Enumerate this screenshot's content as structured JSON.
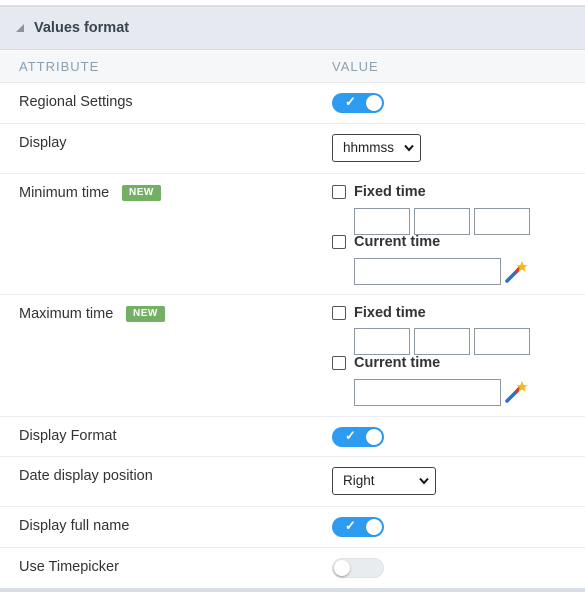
{
  "panel": {
    "title": "Values format",
    "collapse_icon": "triangle-collapse-icon"
  },
  "columns": {
    "attribute": "ATTRIBUTE",
    "value": "VALUE"
  },
  "rows": {
    "regional_settings": {
      "label": "Regional Settings",
      "toggle_on": true
    },
    "display": {
      "label": "Display",
      "selected": "hhmmss"
    },
    "minimum_time": {
      "label": "Minimum time",
      "badge": "NEW",
      "fixed_time_label": "Fixed time",
      "fixed_time_checked": false,
      "current_time_label": "Current time",
      "current_time_checked": false,
      "fixed_values": [
        "",
        "",
        ""
      ],
      "current_value": "",
      "wand_icon": "magic-wand-icon"
    },
    "maximum_time": {
      "label": "Maximum time",
      "badge": "NEW",
      "fixed_time_label": "Fixed time",
      "fixed_time_checked": false,
      "current_time_label": "Current time",
      "current_time_checked": false,
      "fixed_values": [
        "",
        "",
        ""
      ],
      "current_value": "",
      "wand_icon": "magic-wand-icon"
    },
    "display_format": {
      "label": "Display Format",
      "toggle_on": true
    },
    "date_display_position": {
      "label": "Date display position",
      "selected": "Right"
    },
    "display_full_name": {
      "label": "Display full name",
      "toggle_on": true
    },
    "use_timepicker": {
      "label": "Use Timepicker",
      "toggle_on": false
    }
  },
  "colors": {
    "accent": "#2d9cf0",
    "badge": "#74b064",
    "header_bg": "#e6eaf0",
    "column_header_text": "#8aa0b3"
  }
}
